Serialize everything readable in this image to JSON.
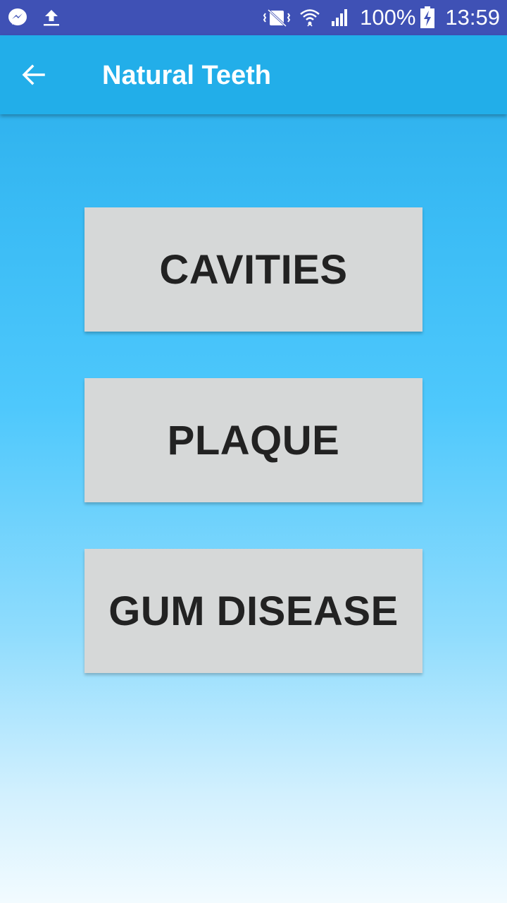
{
  "status_bar": {
    "battery": "100%",
    "time": "13:59",
    "icons": [
      "messenger-icon",
      "upload-icon",
      "vibrate-mute-icon",
      "wifi-icon",
      "signal-icon",
      "battery-charging-icon"
    ]
  },
  "app_bar": {
    "title": "Natural Teeth",
    "back_icon": "arrow-back-icon"
  },
  "buttons": [
    {
      "label": "CAVITIES"
    },
    {
      "label": "PLAQUE"
    },
    {
      "label": "GUM DISEASE"
    }
  ],
  "colors": {
    "status_bar": "#3f51b5",
    "app_bar": "#22aee9",
    "button_bg": "#d6d8d8",
    "button_text": "#222222"
  }
}
